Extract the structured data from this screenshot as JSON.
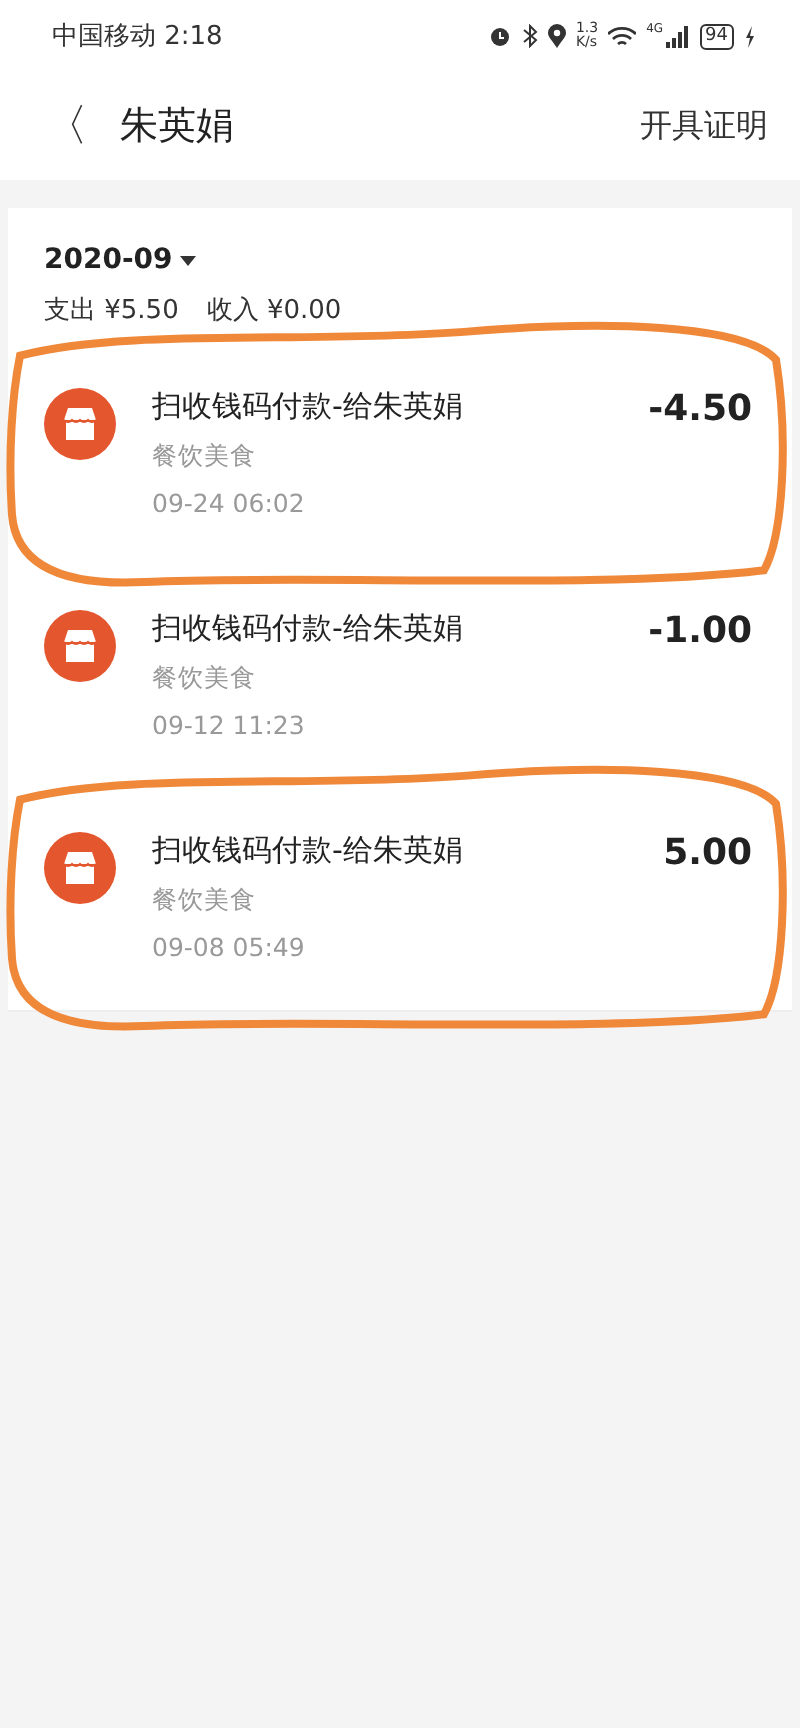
{
  "status_bar": {
    "carrier_time": "中国移动 2:18",
    "speed": [
      "1.3",
      "K/s"
    ],
    "network": "4G",
    "battery": "94"
  },
  "header": {
    "back": "〈",
    "title": "朱英娟",
    "action": "开具证明"
  },
  "summary": {
    "month": "2020-09",
    "expense": "支出 ¥5.50",
    "income": "收入 ¥0.00"
  },
  "transactions": [
    {
      "title": "扫收钱码付款-给朱英娟",
      "category": "餐饮美食",
      "time": "09-24  06:02",
      "amount": "-4.50",
      "circled": true
    },
    {
      "title": "扫收钱码付款-给朱英娟",
      "category": "餐饮美食",
      "time": "09-12  11:23",
      "amount": "-1.00",
      "circled": false
    },
    {
      "title": "扫收钱码付款-给朱英娟",
      "category": "餐饮美食",
      "time": "09-08  05:49",
      "amount": "5.00",
      "circled": true
    }
  ]
}
